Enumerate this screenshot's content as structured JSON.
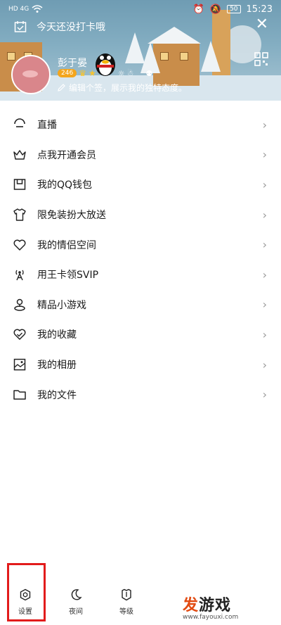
{
  "status_bar": {
    "left_text": "HD 4G",
    "battery": "50",
    "time": "15:23"
  },
  "header": {
    "checkin_text": "今天还没打卡哦",
    "username": "彭于晏",
    "level_badge": "246",
    "signature": "编辑个签，展示我的独特态度。"
  },
  "menu": {
    "items": [
      {
        "label": "直播",
        "icon": "live-icon"
      },
      {
        "label": "点我开通会员",
        "icon": "crown-icon"
      },
      {
        "label": "我的QQ钱包",
        "icon": "wallet-icon"
      },
      {
        "label": "限免装扮大放送",
        "icon": "shirt-icon"
      },
      {
        "label": "我的情侣空间",
        "icon": "heart-icon"
      },
      {
        "label": "用王卡领SVIP",
        "icon": "antenna-icon"
      },
      {
        "label": "精品小游戏",
        "icon": "game-icon"
      },
      {
        "label": "我的收藏",
        "icon": "favorite-heart-icon"
      },
      {
        "label": "我的相册",
        "icon": "album-icon"
      },
      {
        "label": "我的文件",
        "icon": "folder-icon"
      }
    ]
  },
  "bottom_nav": {
    "settings": "设置",
    "night": "夜间",
    "level": "等级"
  },
  "watermark": {
    "title_part1": "发",
    "title_part2": "游戏",
    "url": "www.fayouxi.com"
  },
  "colors": {
    "highlight": "#e21b1b",
    "banner": "#7fa9bd",
    "watermark_orange": "#e24b12"
  }
}
